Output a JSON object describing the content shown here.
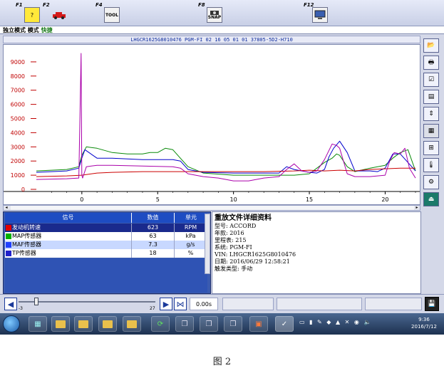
{
  "fkeys": [
    {
      "key": "F1",
      "icon": "help-icon"
    },
    {
      "key": "F2",
      "icon": "car-icon"
    },
    {
      "key": "F4",
      "icon": "tools-icon",
      "text": "TOOL"
    },
    {
      "key": "F8",
      "icon": "camera-icon",
      "text": "SNAP"
    },
    {
      "key": "F12",
      "icon": "monitor-icon"
    }
  ],
  "mode": {
    "text1": "独立模式 模式 ",
    "text2": "快捷"
  },
  "vin_header": "LHGCR1625G8010476  PGM-FI  02 16 05 01 01  37805-5D2-H710",
  "chart_data": {
    "type": "line",
    "x_ticks": [
      0,
      5,
      10,
      15,
      20
    ],
    "y_ticks": [
      0,
      1000,
      2000,
      3000,
      4000,
      5000,
      6000,
      7000,
      8000,
      9000
    ],
    "xlim": [
      -3,
      22
    ],
    "ylim": [
      0,
      9800
    ],
    "grid": false,
    "series": [
      {
        "color": "#0a8a0a",
        "x": [
          -3,
          -1,
          -0.2,
          0,
          0.3,
          1,
          2,
          3,
          4,
          4.5,
          5,
          5.5,
          6,
          7,
          8,
          10,
          12,
          14,
          15,
          15.5,
          16,
          16.5,
          16.8,
          17,
          17.5,
          18,
          19,
          19.5,
          20,
          20.5,
          21,
          21.5,
          22
        ],
        "y": [
          1300,
          1400,
          1600,
          2400,
          3000,
          2900,
          2600,
          2500,
          2500,
          2600,
          2600,
          2900,
          2800,
          1600,
          1150,
          1000,
          1000,
          1000,
          1100,
          1500,
          1900,
          2200,
          2500,
          2400,
          1600,
          1250,
          1500,
          1600,
          1700,
          2200,
          2600,
          2800,
          1300
        ]
      },
      {
        "color": "#0000cc",
        "x": [
          -3,
          -1,
          -0.2,
          0,
          0.2,
          1,
          2,
          4,
          6,
          6.5,
          7,
          8,
          10,
          12,
          13,
          13.5,
          14,
          15,
          15.5,
          16,
          16.3,
          16.6,
          17,
          17.5,
          18,
          19,
          19.5,
          20,
          20.5,
          21,
          22
        ],
        "y": [
          1200,
          1300,
          1500,
          2200,
          2800,
          2200,
          2200,
          2100,
          2100,
          2000,
          1400,
          1200,
          1150,
          1150,
          1150,
          1600,
          1400,
          1200,
          1150,
          1400,
          2300,
          2900,
          3400,
          2600,
          1300,
          1300,
          1250,
          1500,
          2500,
          2500,
          1300
        ]
      },
      {
        "color": "#cc0000",
        "x": [
          -3,
          -1,
          0,
          1,
          2,
          4,
          6,
          8,
          10,
          12,
          14,
          15,
          16,
          17,
          18,
          19,
          20,
          21,
          22
        ],
        "y": [
          900,
          950,
          1000,
          1150,
          1200,
          1250,
          1250,
          1250,
          1250,
          1250,
          1300,
          1350,
          1300,
          1350,
          1300,
          1400,
          1450,
          1500,
          1500
        ]
      },
      {
        "color": "#aa00aa",
        "x": [
          -3,
          -1,
          -0.2,
          -0.05,
          0,
          0.05,
          0.3,
          1,
          2,
          4,
          6,
          6.5,
          7,
          8,
          9,
          10,
          11,
          12,
          13,
          13.5,
          14,
          14.5,
          15,
          15.5,
          16,
          16.5,
          16.8,
          17,
          17.5,
          18,
          19,
          19.5,
          20,
          20.3,
          20.6,
          21,
          21.3,
          21.6,
          22
        ],
        "y": [
          700,
          750,
          800,
          9600,
          1000,
          800,
          1600,
          1700,
          1700,
          1650,
          1600,
          1500,
          1100,
          900,
          800,
          600,
          600,
          800,
          900,
          1400,
          1800,
          1300,
          1200,
          1300,
          2100,
          3200,
          3100,
          2900,
          1100,
          900,
          900,
          950,
          1000,
          2000,
          2600,
          2500,
          2900,
          1500,
          800
        ]
      }
    ]
  },
  "signal_table": {
    "headers": [
      "信号",
      "数值",
      "单元"
    ],
    "rows": [
      {
        "name": "发动机转速",
        "value": "623",
        "unit": "RPM",
        "color": "#e00000",
        "bg": "#1a2a8c",
        "fg": "#ffffff"
      },
      {
        "name": "MAP传感器",
        "value": "63",
        "unit": "kPa",
        "color": "#00b000",
        "bg": "#ffffff",
        "fg": "#000000"
      },
      {
        "name": "MAF传感器",
        "value": "7.3",
        "unit": "g/s",
        "color": "#2040ff",
        "bg": "#c8d8ff",
        "fg": "#000000"
      },
      {
        "name": "TP传感器",
        "value": "18",
        "unit": "%",
        "color": "#2020cc",
        "bg": "#ffffff",
        "fg": "#000000"
      }
    ]
  },
  "detail": {
    "title": "重放文件详细资料",
    "lines": [
      "型号: ACCORD",
      "年款: 2016",
      "里程表:  215",
      "系统: PGM-FI",
      "VIN: LHGCR1625G8010476",
      "日期: 2016/06/29 12:58:21",
      "触发类型: 手动"
    ]
  },
  "playback": {
    "min_label": "-3",
    "max_label": "27",
    "time": "0.00s"
  },
  "taskbar": {
    "time": "9:36",
    "date": "2016/7/12"
  },
  "caption": "图 2"
}
